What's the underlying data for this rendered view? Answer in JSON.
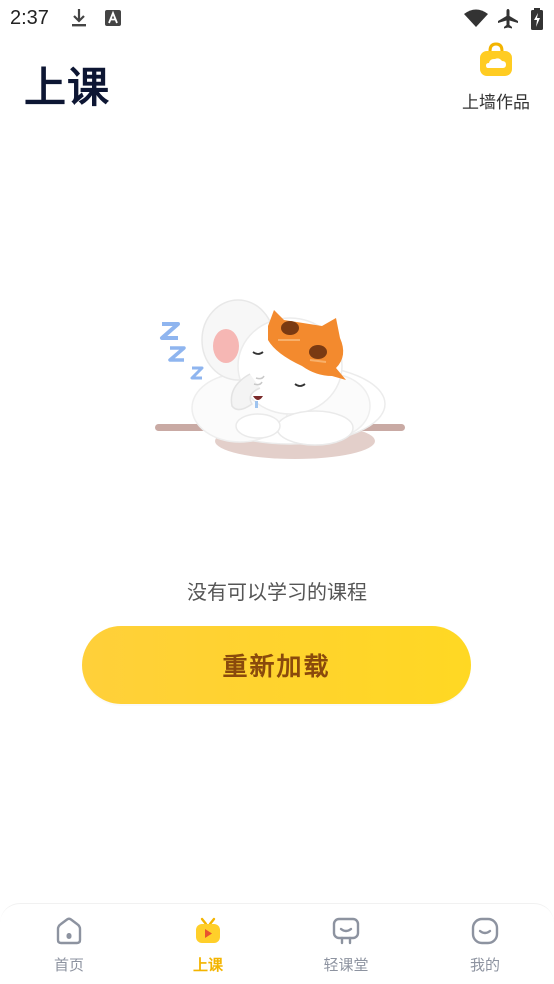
{
  "status_bar": {
    "time": "2:37",
    "icons": [
      "download-icon",
      "text-a-icon",
      "wifi-icon",
      "airplane-icon",
      "battery-charging-icon"
    ]
  },
  "header": {
    "title": "上课",
    "upload_wall_label": "上墙作品",
    "upload_wall_icon": "bag-cloud-icon"
  },
  "empty_state": {
    "illustration": "sleeping-elephant-with-cat-mask",
    "message": "没有可以学习的课程",
    "reload_label": "重新加载"
  },
  "tabs": [
    {
      "label": "首页",
      "icon": "home-icon",
      "active": false
    },
    {
      "label": "上课",
      "icon": "tv-play-icon",
      "active": true
    },
    {
      "label": "轻课堂",
      "icon": "chat-screen-icon",
      "active": false
    },
    {
      "label": "我的",
      "icon": "profile-face-icon",
      "active": false
    }
  ],
  "colors": {
    "accent": "#ffd42b",
    "accent_text": "#8a4a0c",
    "active_tab": "#f3b400",
    "inactive_tab": "#8d93a0",
    "title": "#0d1633"
  }
}
